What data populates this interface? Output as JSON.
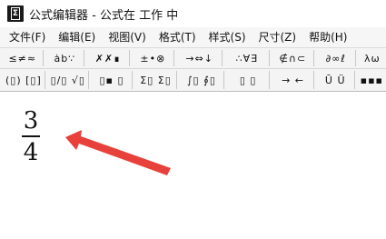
{
  "window": {
    "title": "公式编辑器 - 公式在 工作 中",
    "icon_label": "Σ"
  },
  "menubar": {
    "items": [
      {
        "label": "文件(F)"
      },
      {
        "label": "编辑(E)"
      },
      {
        "label": "视图(V)"
      },
      {
        "label": "格式(T)"
      },
      {
        "label": "样式(S)"
      },
      {
        "label": "尺寸(Z)"
      },
      {
        "label": "帮助(H)"
      }
    ]
  },
  "toolbar": {
    "row1": [
      {
        "label": "≤≠≈",
        "icon": "relational-symbols-icon"
      },
      {
        "label": "ȧb∵",
        "icon": "spaces-and-ellipses-icon"
      },
      {
        "label": "✗✗∎",
        "icon": "embellishments-icon"
      },
      {
        "label": "±•⊗",
        "icon": "operator-symbols-icon"
      },
      {
        "label": "→⇔↓",
        "icon": "arrow-symbols-icon"
      },
      {
        "label": "∴∀∃",
        "icon": "logical-symbols-icon"
      },
      {
        "label": "∉∩⊂",
        "icon": "set-theory-symbols-icon"
      },
      {
        "label": "∂∞ℓ",
        "icon": "misc-symbols-icon"
      },
      {
        "label": "λω",
        "icon": "greek-lowercase-icon"
      }
    ],
    "row2": [
      {
        "label": "(▯) [▯]",
        "icon": "fence-templates-icon"
      },
      {
        "label": "▯/▯ √▯",
        "icon": "fraction-radical-templates-icon"
      },
      {
        "label": "▯▪ ▯",
        "icon": "subscript-superscript-templates-icon"
      },
      {
        "label": "Σ▯ Σ▯",
        "icon": "summation-templates-icon"
      },
      {
        "label": "∫▯ ∮▯",
        "icon": "integral-templates-icon"
      },
      {
        "label": "▯ ▯",
        "icon": "underbar-overbar-templates-icon"
      },
      {
        "label": "→ ←",
        "icon": "labeled-arrow-templates-icon"
      },
      {
        "label": "Ū Ü",
        "icon": "products-set-theory-templates-icon"
      },
      {
        "label": "▪▪▪",
        "icon": "matrix-templates-icon"
      }
    ]
  },
  "equation": {
    "numerator": "3",
    "denominator": "4"
  },
  "colors": {
    "annotation_arrow": "#e8403a"
  }
}
